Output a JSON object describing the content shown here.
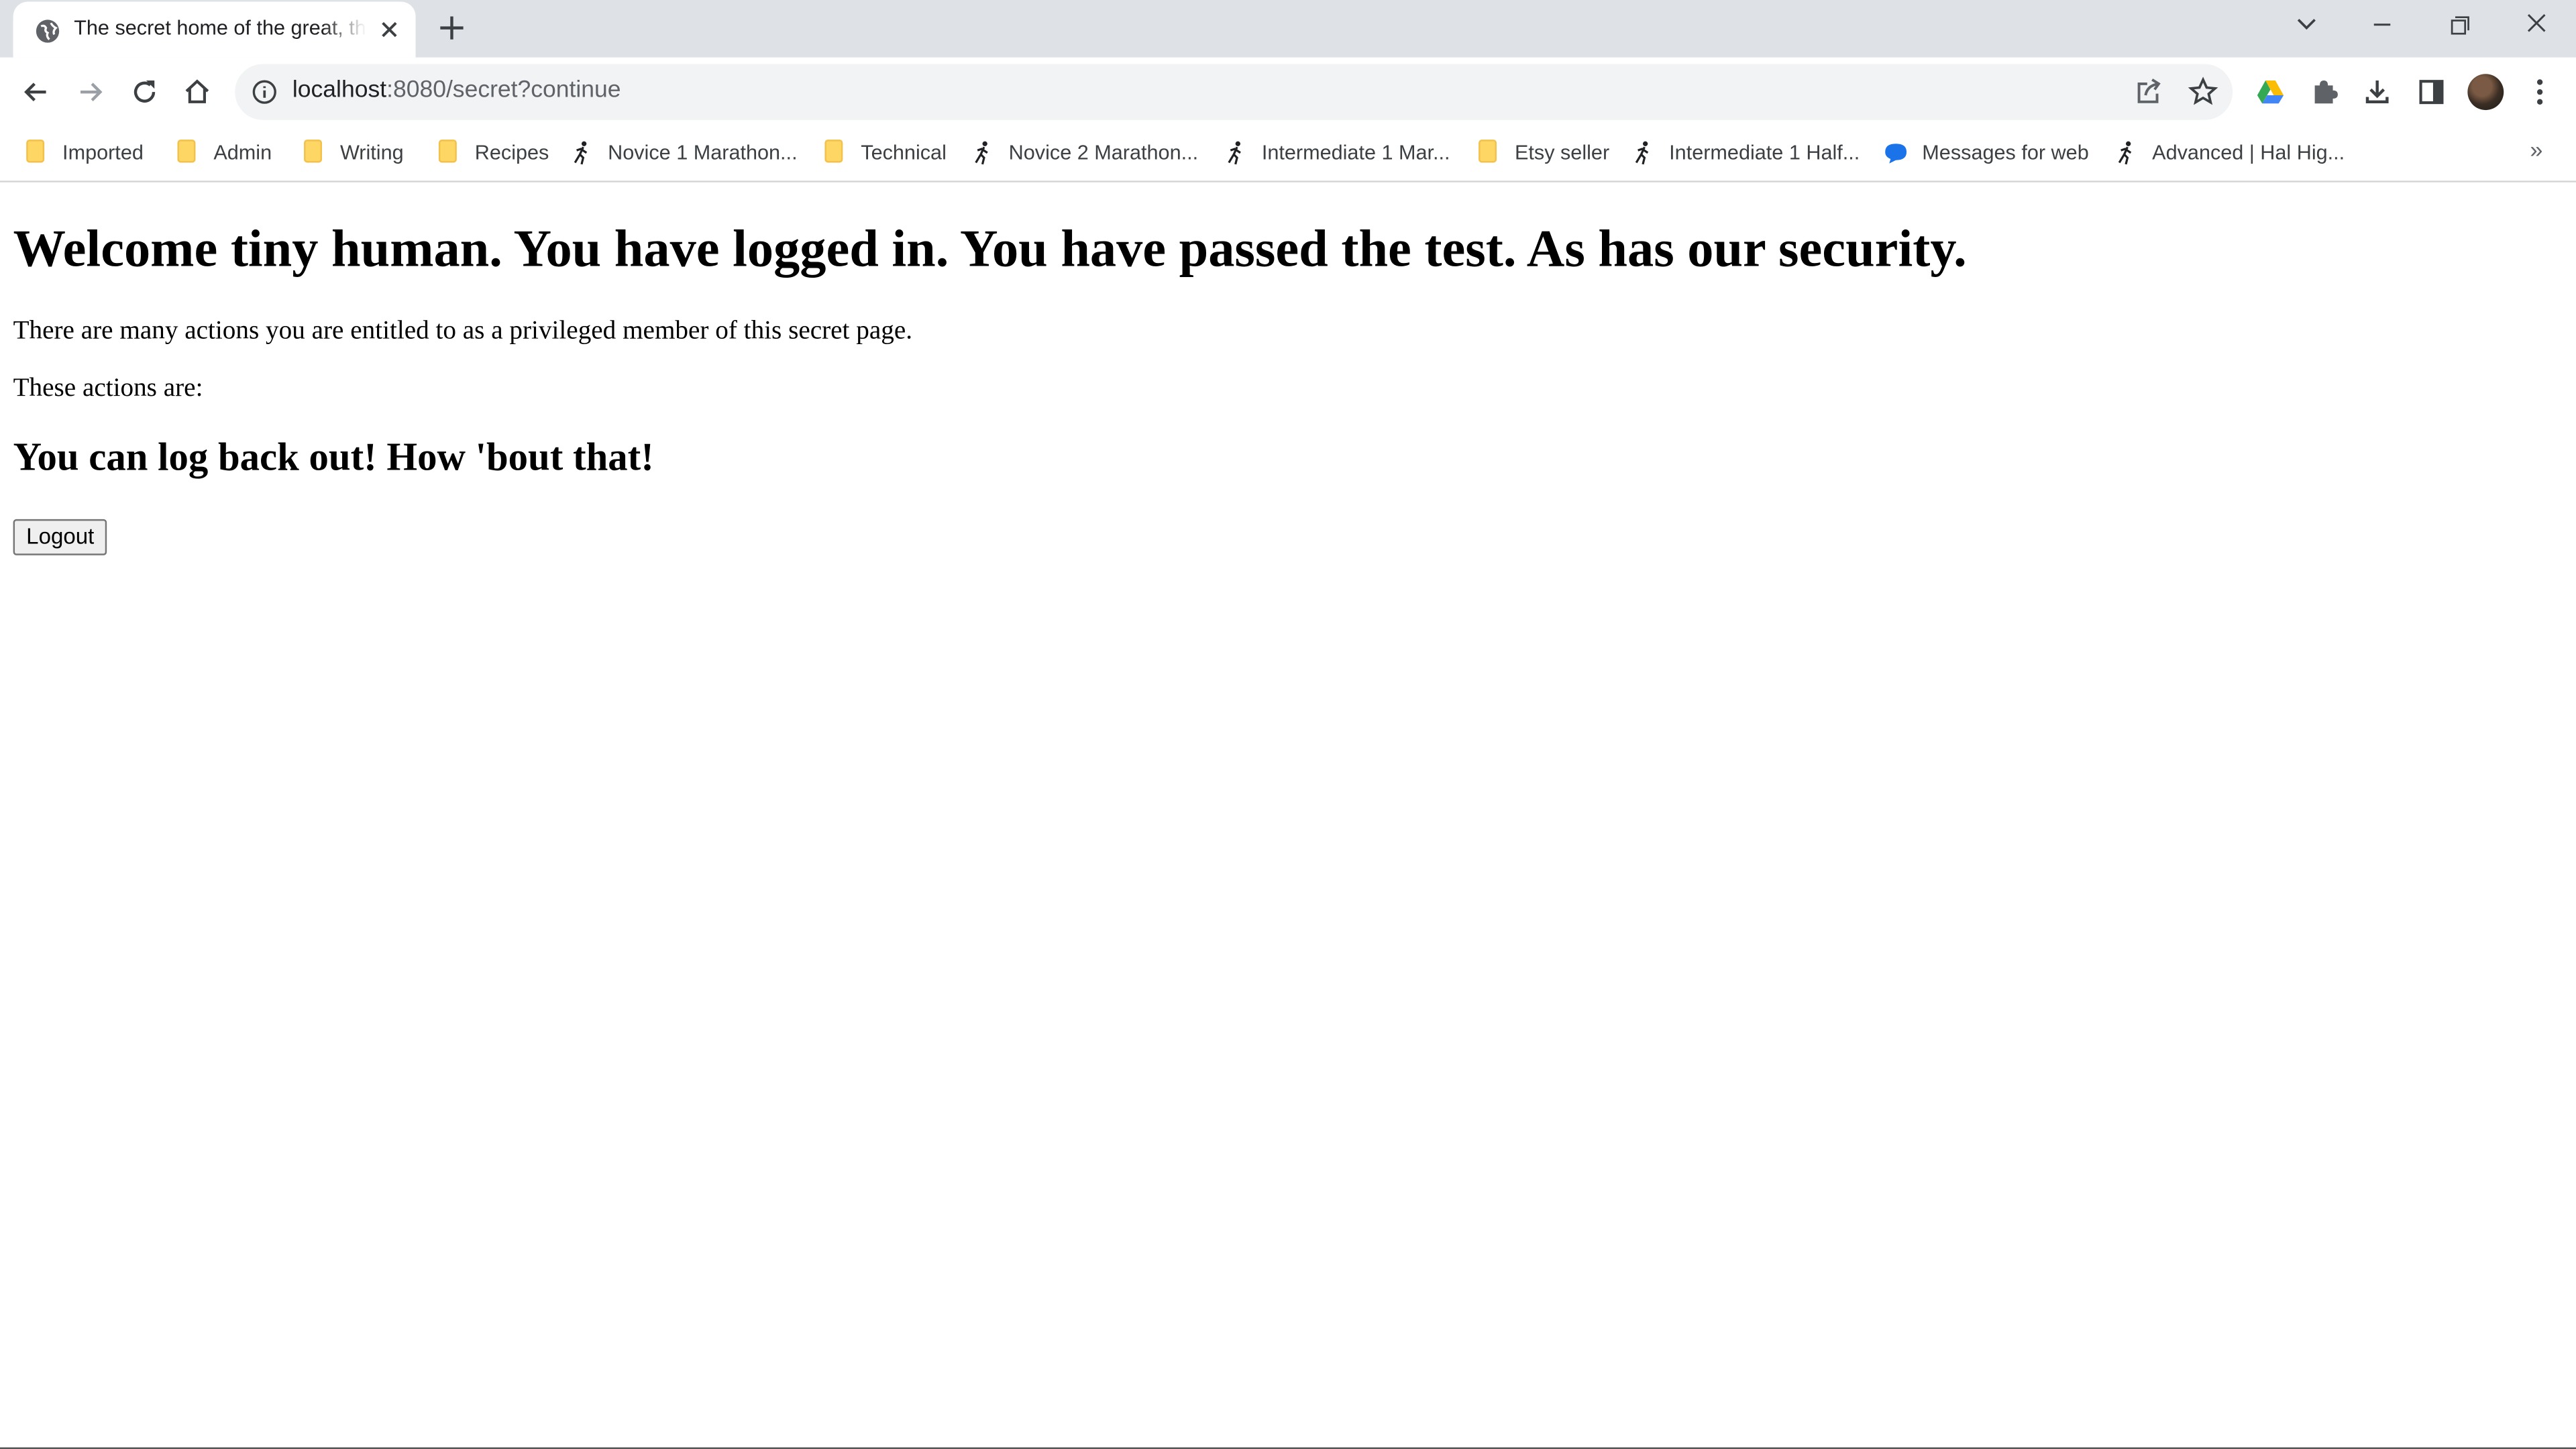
{
  "browser": {
    "tab": {
      "title": "The secret home of the great, the",
      "favicon": "globe-icon"
    },
    "address_bar": {
      "host": "localhost",
      "path": ":8080/secret?continue"
    },
    "bookmarks": [
      {
        "label": "Imported",
        "icon": "folder-icon"
      },
      {
        "label": "Admin",
        "icon": "folder-icon"
      },
      {
        "label": "Writing",
        "icon": "folder-icon"
      },
      {
        "label": "Recipes",
        "icon": "folder-icon"
      },
      {
        "label": "Novice 1 Marathon...",
        "icon": "runner-icon"
      },
      {
        "label": "Technical",
        "icon": "folder-icon"
      },
      {
        "label": "Novice 2 Marathon...",
        "icon": "runner-icon"
      },
      {
        "label": "Intermediate 1 Mar...",
        "icon": "runner-icon"
      },
      {
        "label": "Etsy seller",
        "icon": "folder-icon"
      },
      {
        "label": "Intermediate 1 Half...",
        "icon": "runner-icon"
      },
      {
        "label": "Messages for web",
        "icon": "messages-icon"
      },
      {
        "label": "Advanced | Hal Hig...",
        "icon": "runner-icon"
      }
    ],
    "bookmarks_overflow": "»"
  },
  "page": {
    "heading": "Welcome tiny human. You have logged in. You have passed the test. As has our security.",
    "intro": "There are many actions you are entitled to as a privileged member of this secret page.",
    "actions_label": "These actions are:",
    "subheading": "You can log back out! How 'bout that!",
    "logout_button": "Logout"
  }
}
